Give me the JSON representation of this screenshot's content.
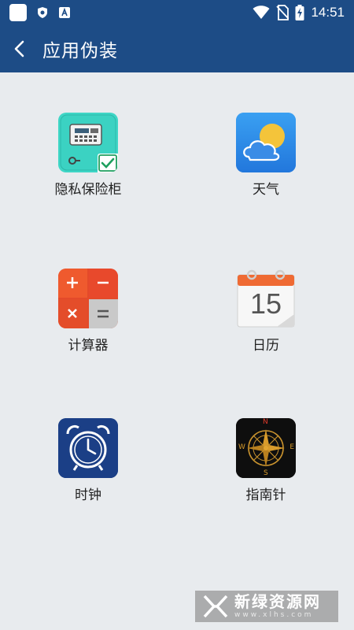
{
  "status_bar": {
    "time": "14:51",
    "icons": [
      "app-square-icon",
      "shield-icon",
      "font-a-icon",
      "wifi-icon",
      "no-sim-icon",
      "battery-charging-icon"
    ]
  },
  "app_bar": {
    "back_icon": "back-arrow-icon",
    "title": "应用伪装"
  },
  "apps": [
    {
      "label": "隐私保险柜",
      "icon": "safe-icon",
      "selected": true
    },
    {
      "label": "天气",
      "icon": "weather-icon"
    },
    {
      "label": "计算器",
      "icon": "calculator-icon"
    },
    {
      "label": "日历",
      "icon": "calendar-icon",
      "day": "15"
    },
    {
      "label": "时钟",
      "icon": "alarm-clock-icon"
    },
    {
      "label": "指南针",
      "icon": "compass-icon",
      "directions": [
        "N",
        "E",
        "S",
        "W"
      ]
    }
  ],
  "watermark": {
    "name": "新绿资源网",
    "url": "www.xlhs.com"
  },
  "colors": {
    "header": "#1d4c86",
    "background": "#e8ebee",
    "check": "#1e9f5e"
  }
}
